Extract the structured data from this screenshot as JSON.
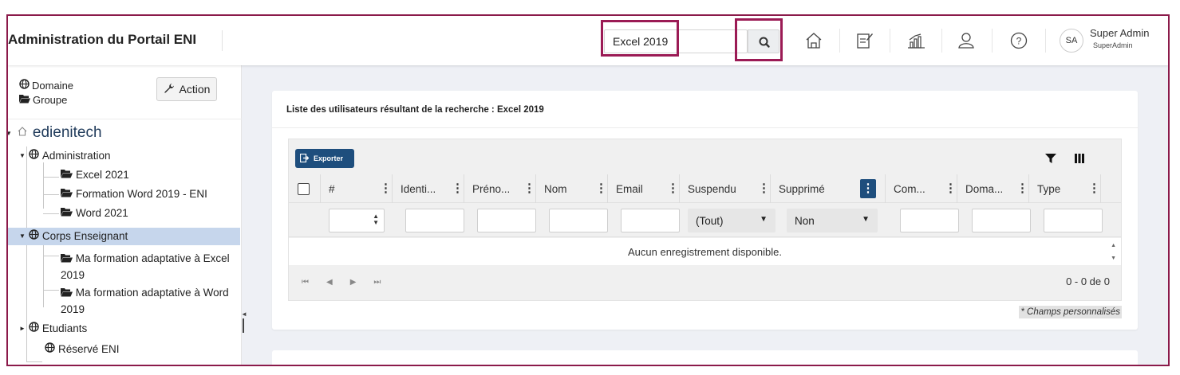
{
  "header": {
    "app_title": "Administration du Portail ENI",
    "search": {
      "value": "Excel 2019",
      "icon": "search-icon"
    },
    "nav_icons": [
      "home-icon",
      "edit-icon",
      "chart-icon",
      "user-icon",
      "help-icon"
    ],
    "user": {
      "initials": "SA",
      "name": "Super Admin",
      "role": "SuperAdmin"
    },
    "highlight_color": "#9b1b55"
  },
  "sidebar": {
    "domain_label": "Domaine",
    "group_label": "Groupe",
    "action_label": "Action",
    "tree": {
      "root": "edienitech",
      "administration": {
        "label": "Administration",
        "children": [
          "Excel 2021",
          "Formation Word 2019 - ENI",
          "Word 2021"
        ]
      },
      "corps": {
        "label": "Corps Enseignant",
        "children": [
          "Ma formation adaptative à Excel 2019",
          "Ma formation adaptative à Word 2019"
        ]
      },
      "etudiants": "Etudiants",
      "reserve": "Réservé ENI"
    }
  },
  "main": {
    "card_title": "Liste des utilisateurs résultant de la recherche : Excel 2019",
    "export_label": "Exporter",
    "columns": [
      "#",
      "Identi...",
      "Préno...",
      "Nom",
      "Email",
      "Suspendu",
      "Supprimé",
      "Com...",
      "Doma...",
      "Type"
    ],
    "filters": {
      "suspendu": "(Tout)",
      "supprime": "Non"
    },
    "empty_message": "Aucun enregistrement disponible.",
    "pager_info": "0 - 0 de 0",
    "custom_fields_note": "* Champs personnalisés",
    "accent_color": "#1e4e7d"
  }
}
